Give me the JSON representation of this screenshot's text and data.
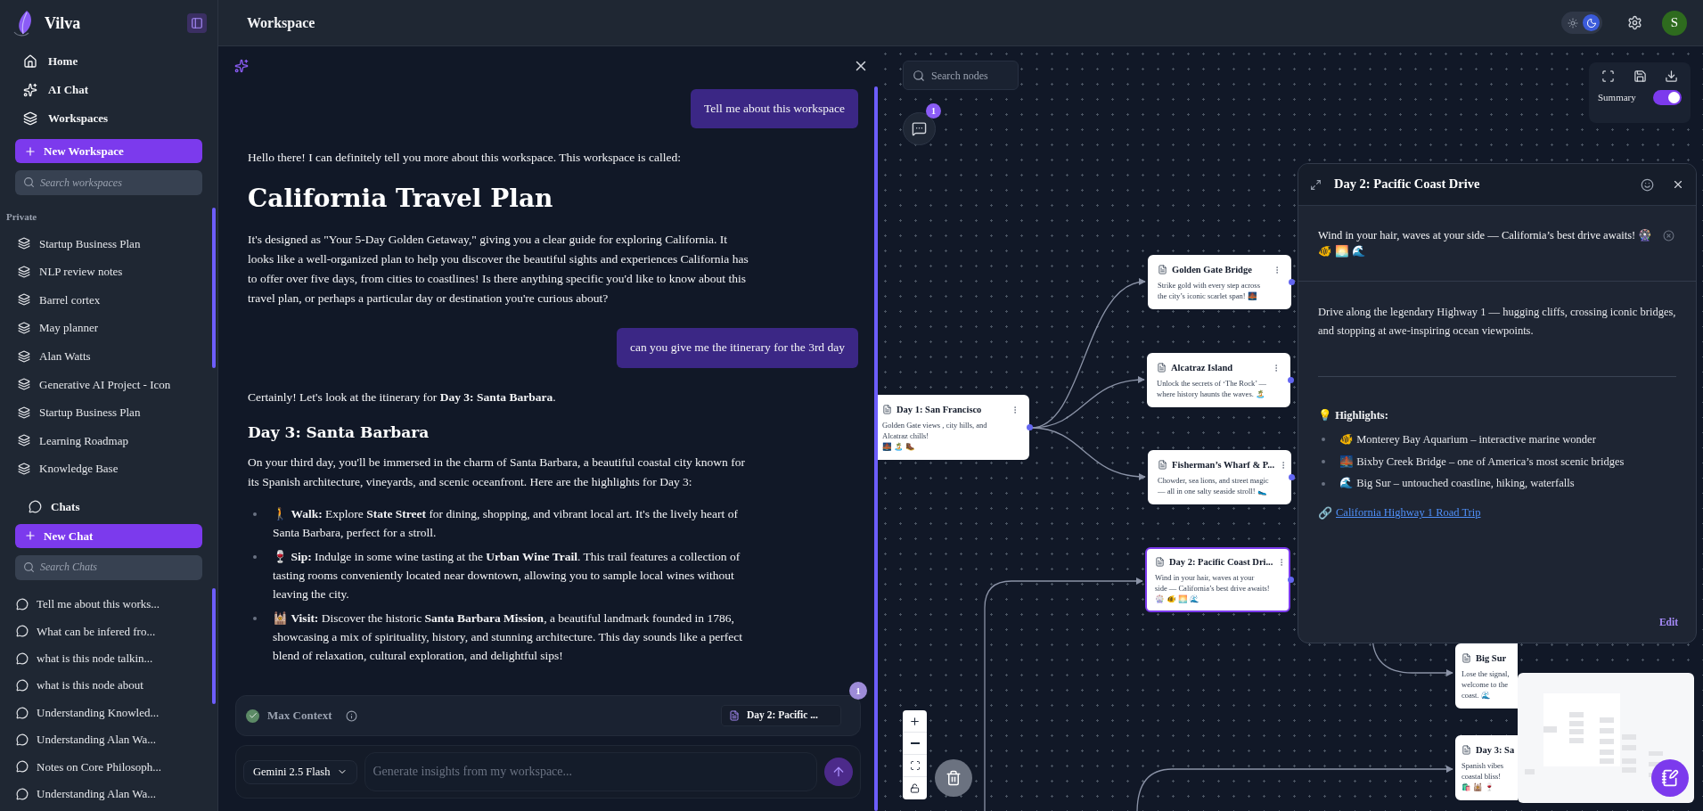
{
  "app": {
    "name": "Vilva"
  },
  "nav": [
    {
      "kind": "home",
      "label": "Home"
    },
    {
      "kind": "sparkles",
      "label": "AI Chat"
    },
    {
      "kind": "layers",
      "label": "Workspaces"
    }
  ],
  "new_workspace_button": "New Workspace",
  "workspace_search": {
    "placeholder": "Search workspaces"
  },
  "private_section": {
    "title": "Private",
    "items": [
      "Startup Business Plan",
      "NLP review notes",
      "Barrel cortex",
      "May planner",
      "Alan Watts",
      "Generative AI Project - Icon",
      "Startup Business Plan",
      "Learning Roadmap",
      "Knowledge Base"
    ]
  },
  "chats_section": {
    "title": "Chats",
    "new_button": "New Chat",
    "search": {
      "placeholder": "Search Chats"
    },
    "items": [
      "Tell me about this works...",
      "What can be infered fro...",
      "what is this node talkin...",
      "what is this node about",
      "Understanding Knowled...",
      "Understanding Alan Wa...",
      "Notes on Core Philosoph...",
      "Understanding Alan Wa..."
    ]
  },
  "topbar": {
    "title": "Workspace",
    "theme": [
      {
        "kind": "light",
        "selected": false
      },
      {
        "kind": "dark",
        "selected": true
      }
    ],
    "avatar": "S"
  },
  "chat": {
    "messages": [
      {
        "kind": "user",
        "text": "Tell me about this workspace"
      },
      {
        "kind": "assistant",
        "blocks": [
          {
            "kind": "paragraph",
            "text": "Hello there! I can definitely tell you more about this workspace. This workspace is called:"
          },
          {
            "kind": "title",
            "text": "California Travel Plan"
          },
          {
            "kind": "paragraph",
            "text": "It's designed as \"Your 5-Day Golden Getaway,\" giving you a clear guide for exploring California. It looks like a well-organized plan to help you discover the beautiful sights and experiences California has to offer over five days, from cities to coastlines! Is there anything specific you'd like to know about this travel plan, or perhaps a particular day or destination you're curious about?"
          }
        ]
      },
      {
        "kind": "user",
        "text": "can you give me the itinerary for the 3rd day"
      },
      {
        "kind": "assistant",
        "blocks": [
          {
            "kind": "paragraph",
            "text": "Certainly! Let's look at the itinerary for **Day 3: Santa Barbara**."
          },
          {
            "kind": "heading",
            "text": "Day 3: Santa Barbara"
          },
          {
            "kind": "paragraph",
            "text": "On your third day, you'll be immersed in the charm of Santa Barbara, a beautiful coastal city known for its Spanish architecture, vineyards, and scenic oceanfront. Here are the highlights for Day 3:"
          },
          {
            "kind": "list",
            "items": [
              "🚶 **Walk:** Explore **State Street** for dining, shopping, and vibrant local art. It's the lively heart of Santa Barbara, perfect for a stroll.",
              "🍷 **Sip:** Indulge in some wine tasting at the **Urban Wine Trail**. This trail features a collection of tasting rooms conveniently located near downtown, allowing you to sample local wines without leaving the city.",
              "🕍 **Visit:** Discover the historic **Santa Barbara Mission**, a beautiful landmark founded in 1786, showcasing a mix of spirituality, history, and stunning architecture. This day sounds like a perfect blend of relaxation, cultural exploration, and delightful sips!"
            ]
          }
        ]
      }
    ],
    "context": {
      "label": "Max Context",
      "checked": true,
      "attachment": "Day 2: Pacific ...",
      "count": "1"
    },
    "composer": {
      "model": "Gemini 2.5 Flash",
      "placeholder": "Generate insights from my workspace..."
    }
  },
  "canvas": {
    "search": {
      "placeholder": "Search nodes"
    },
    "chat_badge": "1",
    "summary": {
      "label": "Summary",
      "on": true
    },
    "nodes": [
      {
        "title": "Day 1: San Francisco",
        "lines": [
          "Golden Gate views , city hills, and",
          "Alcatraz chills!",
          "🌉 🏝️ 🥾"
        ],
        "selected": false
      },
      {
        "title": "Golden Gate Bridge",
        "lines": [
          "Strike gold with every step across",
          "the city’s iconic scarlet span! 🌉"
        ],
        "selected": false
      },
      {
        "title": "Alcatraz Island",
        "lines": [
          "Unlock the secrets of ‘The Rock’ —",
          "where history haunts the waves. 🏝️"
        ],
        "selected": false
      },
      {
        "title": "Fisherman’s Wharf & P...",
        "lines": [
          "Chowder, sea lions, and street magic",
          "— all in one salty seaside stroll! 🥿"
        ],
        "selected": false
      },
      {
        "title": "Day 2: Pacific Coast Dri...",
        "lines": [
          "Wind in your hair, waves at your",
          "side — California’s best drive awaits!",
          "🎡 🐠 🌅 🌊"
        ],
        "selected": true
      },
      {
        "title": "Big Sur",
        "lines": [
          "Lose the signal,",
          "welcome to the",
          "coast. 🌊"
        ],
        "selected": false
      },
      {
        "title": "Day 3: Sa",
        "lines": [
          "Spanish vibes",
          "coastal bliss!",
          "🛍️ 🕍 🍷"
        ],
        "selected": false
      }
    ]
  },
  "detail": {
    "title": "Day 2: Pacific Coast Drive",
    "summary": "Wind in your hair, waves at your side — California’s best drive awaits! 🎡 🐠 🌅 🌊",
    "description": "Drive along the legendary Highway 1 — hugging cliffs, crossing iconic bridges, and stopping at awe-inspiring ocean viewpoints.",
    "highlights_heading": "💡 **Highlights:**",
    "highlights": [
      "🐠 Monterey Bay Aquarium – interactive marine wonder",
      "🌉 Bixby Creek Bridge – one of America’s most scenic bridges",
      "🌊 Big Sur – untouched coastline, hiking, waterfalls"
    ],
    "link_icon": "🔗",
    "link": "California Highway 1 Road Trip",
    "edit": "Edit"
  }
}
